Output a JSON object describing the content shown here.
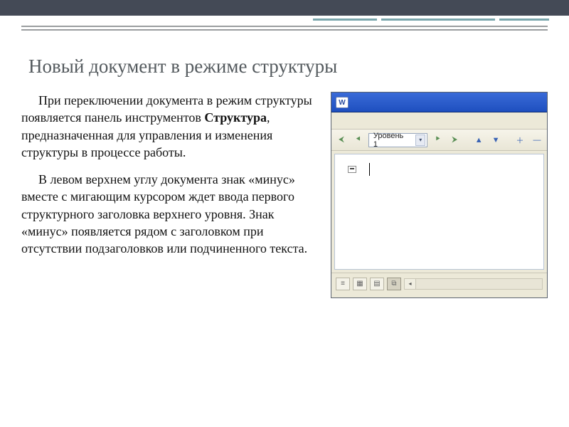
{
  "slide": {
    "title": "Новый документ в режиме структуры",
    "paragraph1_prefix": "При переключении документа в режим структуры появляется панель инструментов ",
    "paragraph1_bold": "Структура",
    "paragraph1_suffix": ", предназначенная для управления и изменения структуры в процессе работы.",
    "paragraph2": "В левом верхнем углу документа знак «минус» вместе с мигающим курсором ждет ввода первого структурного заголовка верхнего уровня. Знак «минус» появляется рядом с заголовком при отсутствии подзаголовков или подчиненного текста."
  },
  "word_window": {
    "doc_badge": "W",
    "toolbar": {
      "double_left": "⮜",
      "single_left": "⯇",
      "level_label": "Уровень 1",
      "dropdown_glyph": "▾",
      "single_right": "⯈",
      "double_right": "⮞",
      "up": "▲",
      "down": "▼",
      "plus": "＋",
      "minus": "—"
    },
    "view_buttons": {
      "normal": "≡",
      "web": "▦",
      "print": "▤",
      "outline": "⧉"
    },
    "hscroll_arrow": "◂"
  }
}
